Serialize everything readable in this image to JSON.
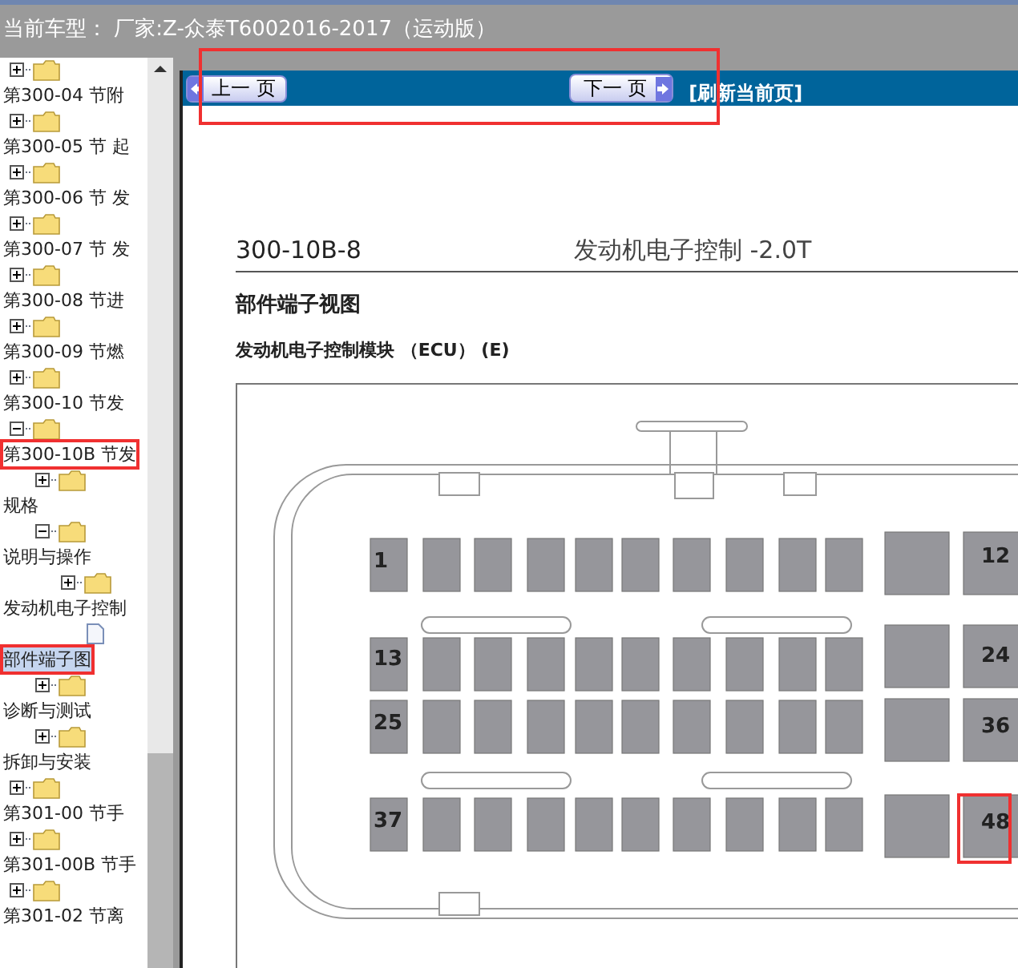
{
  "header": {
    "title": "当前车型：  厂家:Z-众泰T6002016-2017（运动版）"
  },
  "tree": [
    {
      "label": "第300-04 节附",
      "expanded": false,
      "selected": false,
      "highlighted": false
    },
    {
      "label": "第300-05 节 起",
      "expanded": false,
      "selected": false,
      "highlighted": false
    },
    {
      "label": "第300-06 节 发",
      "expanded": false,
      "selected": false,
      "highlighted": false
    },
    {
      "label": "第300-07 节 发",
      "expanded": false,
      "selected": false,
      "highlighted": false
    },
    {
      "label": "第300-08 节进",
      "expanded": false,
      "selected": false,
      "highlighted": false
    },
    {
      "label": "第300-09 节燃",
      "expanded": false,
      "selected": false,
      "highlighted": false
    },
    {
      "label": "第300-10 节发",
      "expanded": false,
      "selected": false,
      "highlighted": false
    },
    {
      "label": "第300-10B 节发",
      "expanded": true,
      "selected": false,
      "highlighted": true,
      "children": [
        {
          "label": "规格",
          "expanded": false,
          "selected": false,
          "highlighted": false
        },
        {
          "label": "说明与操作",
          "expanded": true,
          "selected": false,
          "highlighted": false,
          "children": [
            {
              "label": "发动机电子控制",
              "expanded": false,
              "selected": false,
              "highlighted": false,
              "children": [
                {
                  "label": "部件端子图",
                  "kind": "document",
                  "selected": true,
                  "highlighted": true
                }
              ]
            }
          ]
        },
        {
          "label": "诊断与测试",
          "expanded": false,
          "selected": false,
          "highlighted": false
        },
        {
          "label": "拆卸与安装",
          "expanded": false,
          "selected": false,
          "highlighted": false
        }
      ]
    },
    {
      "label": "第301-00 节手",
      "expanded": false,
      "selected": false,
      "highlighted": false
    },
    {
      "label": "第301-00B 节手",
      "expanded": false,
      "selected": false,
      "highlighted": false
    },
    {
      "label": "第301-02 节离",
      "expanded": false,
      "selected": false,
      "highlighted": false
    }
  ],
  "nav": {
    "prev": "上一 页",
    "next": "下一 页",
    "refresh": "[刷新当前页]"
  },
  "document": {
    "page_number": "300-10B-8",
    "section_title": "发动机电子控制 -2.0T",
    "heading": "部件端子视图",
    "subheading": "发动机电子控制模块 （ECU） (E)",
    "connector": {
      "left_pin_labels": [
        "1",
        "13",
        "25",
        "37"
      ],
      "right_pin_labels": [
        "12",
        "24",
        "36",
        "48"
      ]
    }
  }
}
